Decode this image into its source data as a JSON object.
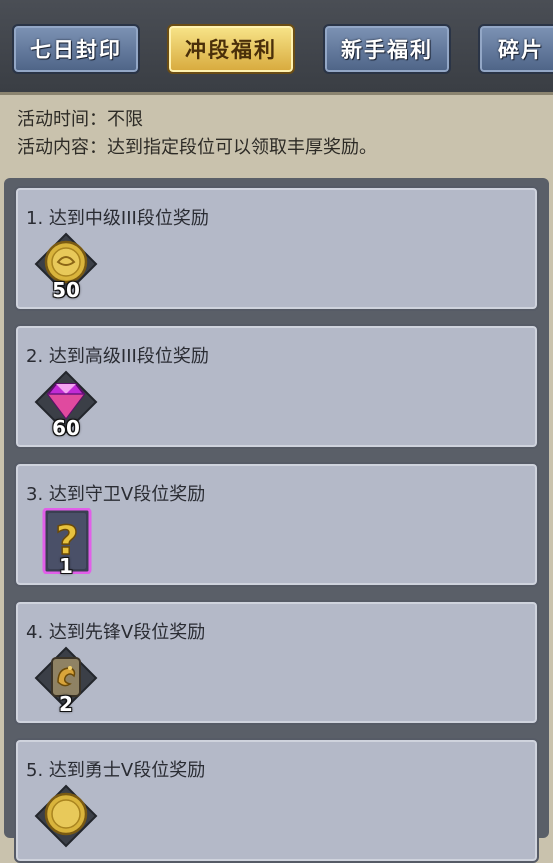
{
  "tabs": [
    {
      "label": "七日封印",
      "active": false
    },
    {
      "label": "冲段福利",
      "active": true
    },
    {
      "label": "新手福利",
      "active": false
    },
    {
      "label": "碎片",
      "active": false
    }
  ],
  "activity": {
    "time_label": "活动时间：",
    "time_value": "不限",
    "content_label": "活动内容：",
    "content_value": "达到指定段位可以领取丰厚奖励。"
  },
  "rewards": [
    {
      "title": "1.  达到中级III段位奖励",
      "icon": "gold-coin-icon",
      "quantity": "50"
    },
    {
      "title": "2.  达到高级III段位奖励",
      "icon": "purple-diamond-icon",
      "quantity": "60"
    },
    {
      "title": "3.  达到守卫V段位奖励",
      "icon": "mystery-card-icon",
      "quantity": "1"
    },
    {
      "title": "4.  达到先锋V段位奖励",
      "icon": "dragon-token-icon",
      "quantity": "2"
    },
    {
      "title": "5.  达到勇士V段位奖励",
      "icon": "gold-coin-icon",
      "quantity": ""
    }
  ],
  "colors": {
    "tab_normal": "#5f7599",
    "tab_active": "#e9c95f",
    "card_bg": "#b4b9c8",
    "page_bg": "#c9c2ad"
  }
}
